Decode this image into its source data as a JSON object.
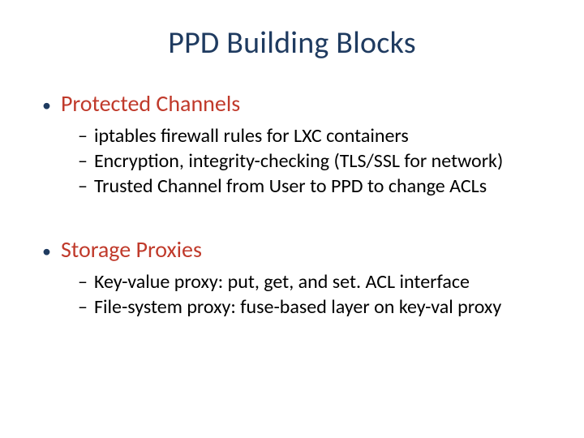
{
  "title": "PPD Building Blocks",
  "sections": [
    {
      "heading": "Protected Channels",
      "items": [
        "iptables firewall rules for LXC containers",
        "Encryption, integrity-checking (TLS/SSL for network)",
        "Trusted Channel from User to PPD to change ACLs"
      ]
    },
    {
      "heading": "Storage Proxies",
      "items": [
        "Key-value proxy: put, get, and set. ACL interface",
        "File-system proxy: fuse-based layer on key-val proxy"
      ]
    }
  ]
}
